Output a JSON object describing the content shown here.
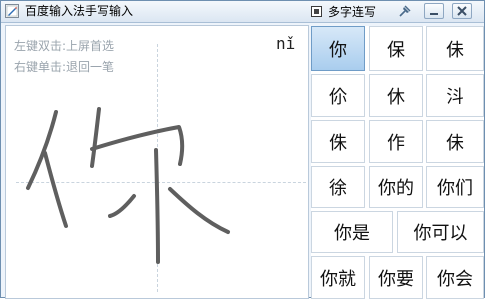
{
  "window": {
    "title": "百度输入法手写输入",
    "multi_char_label": "多字连写"
  },
  "icons": {
    "app": "handwriting-app-icon",
    "pin": "pin-icon",
    "minimize": "minimize-icon",
    "close": "close-icon"
  },
  "canvas": {
    "hint_left": "左键双击:上屏首选",
    "hint_right": "右键单击:退回一笔",
    "pinyin": "nǐ"
  },
  "candidates": [
    {
      "text": "你",
      "selected": true
    },
    {
      "text": "保"
    },
    {
      "text": "佅"
    },
    {
      "text": "伱"
    },
    {
      "text": "休"
    },
    {
      "text": "㳆"
    },
    {
      "text": "侏"
    },
    {
      "text": "作"
    },
    {
      "text": "佅"
    },
    {
      "text": "徐"
    },
    {
      "text": "你的"
    },
    {
      "text": "你们"
    },
    {
      "text": "你是"
    },
    {
      "text": "你可以"
    },
    {
      "text": "你就"
    },
    {
      "text": "你要"
    },
    {
      "text": "你会"
    }
  ]
}
